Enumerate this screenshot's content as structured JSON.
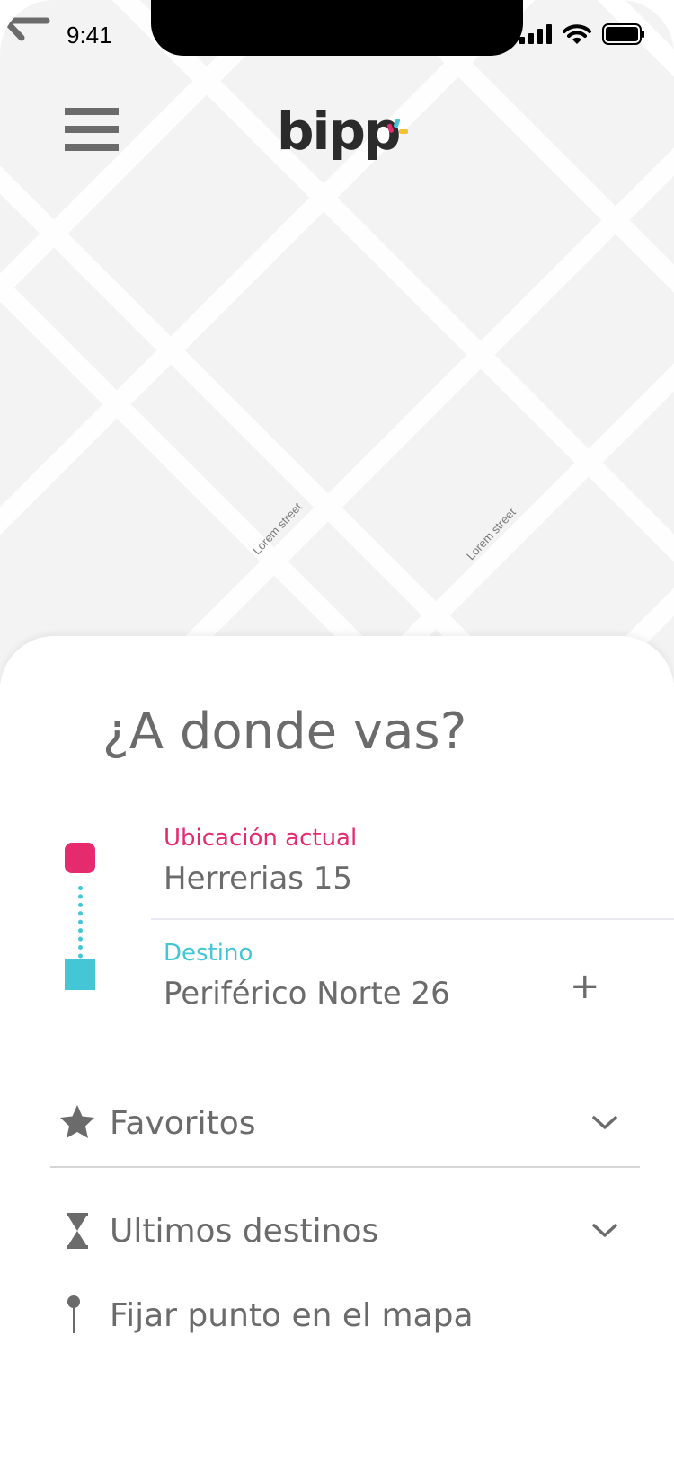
{
  "status_bar": {
    "time": "9:41",
    "icons": [
      "cellular-signal-icon",
      "wifi-icon",
      "battery-icon"
    ]
  },
  "header": {
    "menu_icon": "hamburger-menu-icon",
    "logo_text": "bipp"
  },
  "map": {
    "street_labels": [
      "Lorem street",
      "Lorem street"
    ],
    "back_icon": "arrow-left-icon"
  },
  "sheet": {
    "title": "¿A donde vas?",
    "origin": {
      "label": "Ubicación actual",
      "value": "Herrerias 15"
    },
    "destination": {
      "label": "Destino",
      "value": "Periférico Norte 26",
      "add_label": "+"
    },
    "options": [
      {
        "label": "Favoritos",
        "icon": "star-icon"
      },
      {
        "label": "Ultimos destinos",
        "icon": "hourglass-icon"
      },
      {
        "label": "Fijar punto en el mapa",
        "icon": "map-pin-icon"
      }
    ]
  },
  "colors": {
    "origin": "#e52b6e",
    "destination": "#45c6d6",
    "text_gray": "#6b6b6b",
    "map_bg": "#f4f3f4"
  }
}
